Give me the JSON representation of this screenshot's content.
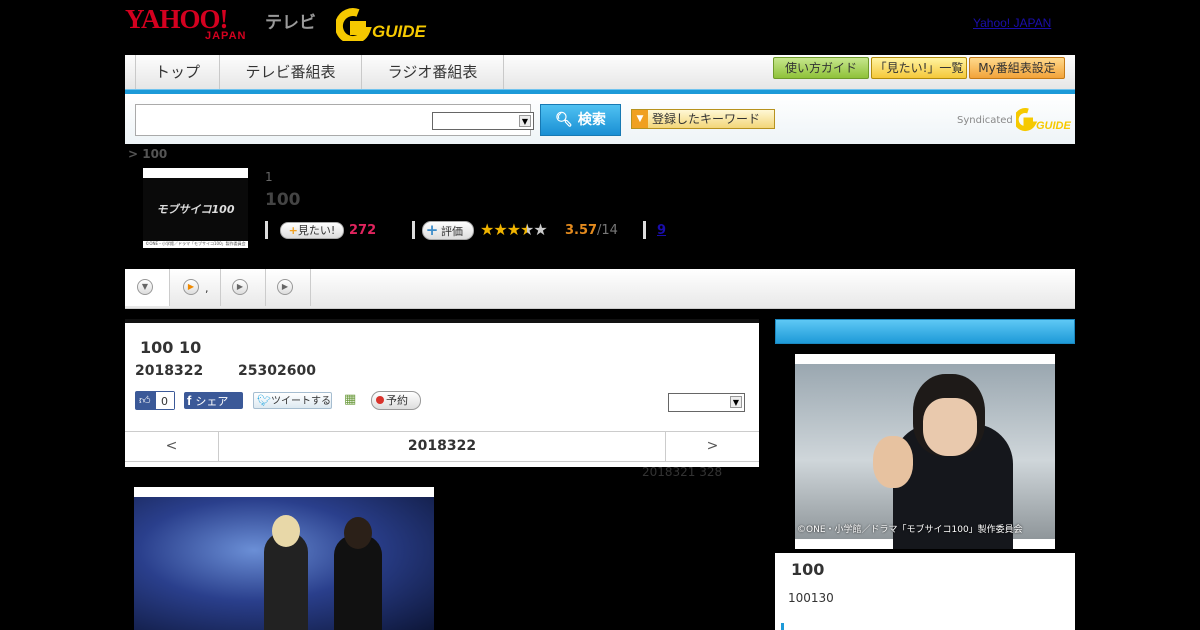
{
  "header": {
    "yahoo_logo": "YAHOO!",
    "yahoo_japan": "JAPAN",
    "tv_label": "テレビ",
    "gguide_logo": "GUIDE",
    "top_link": "Yahoo! JAPAN"
  },
  "nav": {
    "tabs": [
      "トップ",
      "テレビ番組表",
      "ラジオ番組表"
    ],
    "buttons": [
      "使い方ガイド",
      "「見たい!」一覧",
      "My番組表設定"
    ]
  },
  "search": {
    "button_label": "検索",
    "keyword_button": "登録したキーワード",
    "syndicated": "Syndicated"
  },
  "breadcrumb": "> 100",
  "program": {
    "thumb_logo": "モブサイコ100",
    "thumb_caption": "©ONE・小学館／ドラマ「モブサイコ100」製作委員会",
    "episode_label": "1",
    "title": "100",
    "mitai_label": "見たい!",
    "mitai_count": "272",
    "hyoka_label": "評価",
    "rating_value": 3.57,
    "rating": "3.57",
    "rating_count": "/14",
    "link_count": "9"
  },
  "subtabs": {
    "dot": ","
  },
  "episode": {
    "title": "100 10",
    "date": "2018322",
    "time": "25302600",
    "fb_like_count": "0",
    "fb_share": "シェア",
    "tweet": "ツイートする",
    "yoyaku": "予約",
    "day_prev": "<",
    "day_center": "2018322",
    "day_next": ">",
    "update_note": "2018321  328"
  },
  "side": {
    "photo_caption": "©ONE・小学館／ドラマ「モブサイコ100」製作委員会",
    "title": "100",
    "subtitle": "100130"
  },
  "colors": {
    "accent_blue": "#1c9ad8",
    "mitai_pink": "#e0245e",
    "rating_orange": "#e38a1e"
  }
}
